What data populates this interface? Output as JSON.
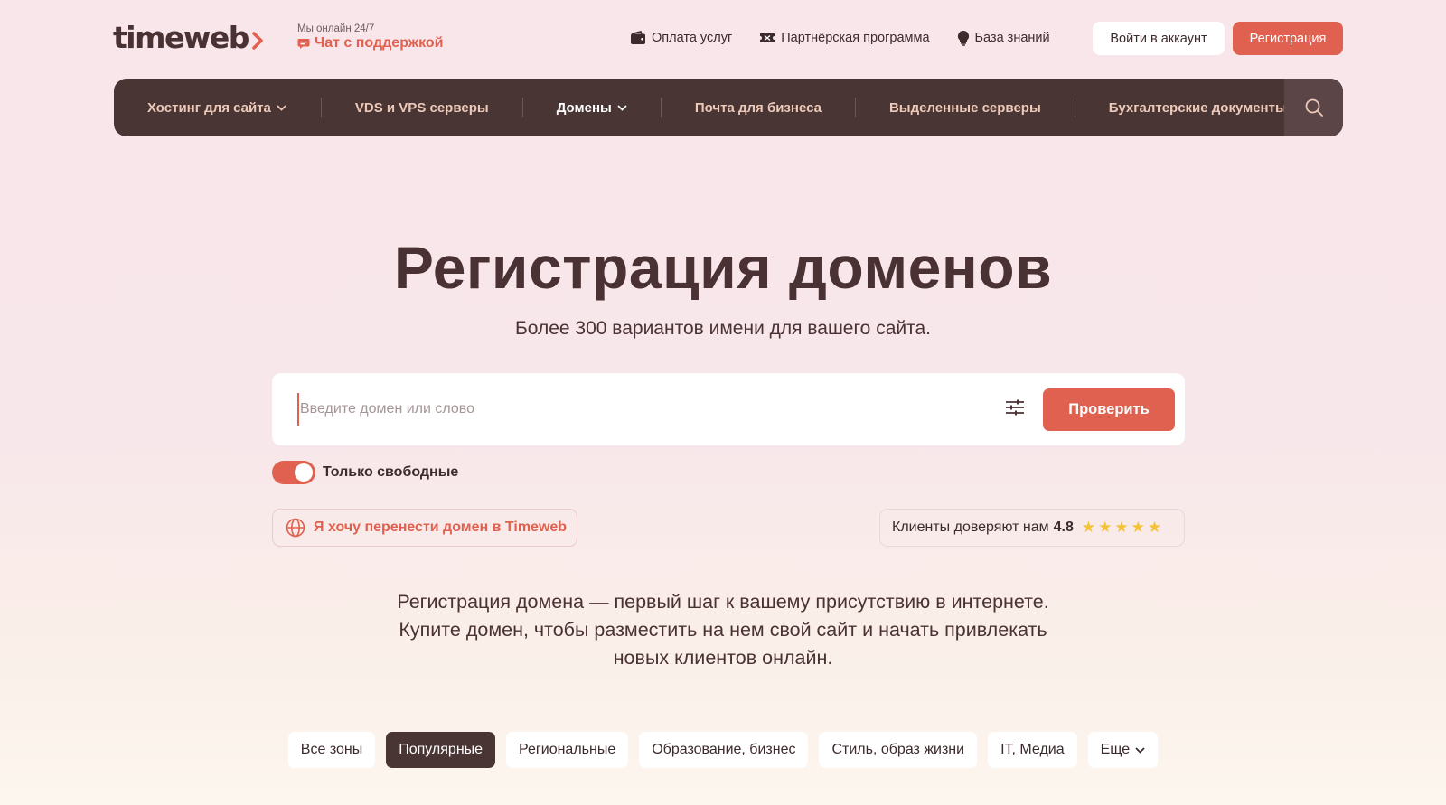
{
  "header": {
    "logo": "timeweb",
    "support_online": "Мы онлайн 24/7",
    "support_chat": "Чат с поддержкой",
    "links": [
      {
        "label": "Оплата услуг",
        "icon": "wallet-icon"
      },
      {
        "label": "Партнёрская программа",
        "icon": "ticket-icon"
      },
      {
        "label": "База знаний",
        "icon": "lightbulb-icon"
      }
    ],
    "login": "Войти в аккаунт",
    "register": "Регистрация"
  },
  "nav": {
    "items": [
      {
        "label": "Хостинг для сайта",
        "dropdown": true
      },
      {
        "label": "VDS и VPS серверы",
        "dropdown": false
      },
      {
        "label": "Домены",
        "dropdown": true
      },
      {
        "label": "Почта для бизнеса",
        "dropdown": false
      },
      {
        "label": "Выделенные серверы",
        "dropdown": false
      },
      {
        "label": "Бухгалтерские документы",
        "dropdown": false
      }
    ],
    "active_index": 2
  },
  "hero": {
    "title": "Регистрация доменов",
    "subtitle": "Более 300 вариантов имени для вашего сайта.",
    "search_placeholder": "Введите домен или слово",
    "search_value": "",
    "check_button": "Проверить",
    "toggle_label": "Только свободные",
    "toggle_on": true,
    "transfer": "Я хочу перенести домен в Timeweb",
    "trust_text": "Клиенты доверяют нам",
    "trust_rating": "4.8",
    "stars": 5,
    "description_lines": [
      "Регистрация домена — первый шаг к вашему присутствию в интернете.",
      "Купите домен, чтобы разместить на нем свой сайт и начать привлекать",
      "новых клиентов онлайн."
    ]
  },
  "zones": {
    "tabs": [
      "Все зоны",
      "Популярные",
      "Региональные",
      "Образование, бизнес",
      "Стиль, образ жизни",
      "IT, Медиа",
      "Еще"
    ],
    "active_index": 1
  },
  "colors": {
    "accent": "#e0614f",
    "dark": "#4a3535",
    "nav_text": "#edc9b8",
    "star": "#f3c236"
  }
}
